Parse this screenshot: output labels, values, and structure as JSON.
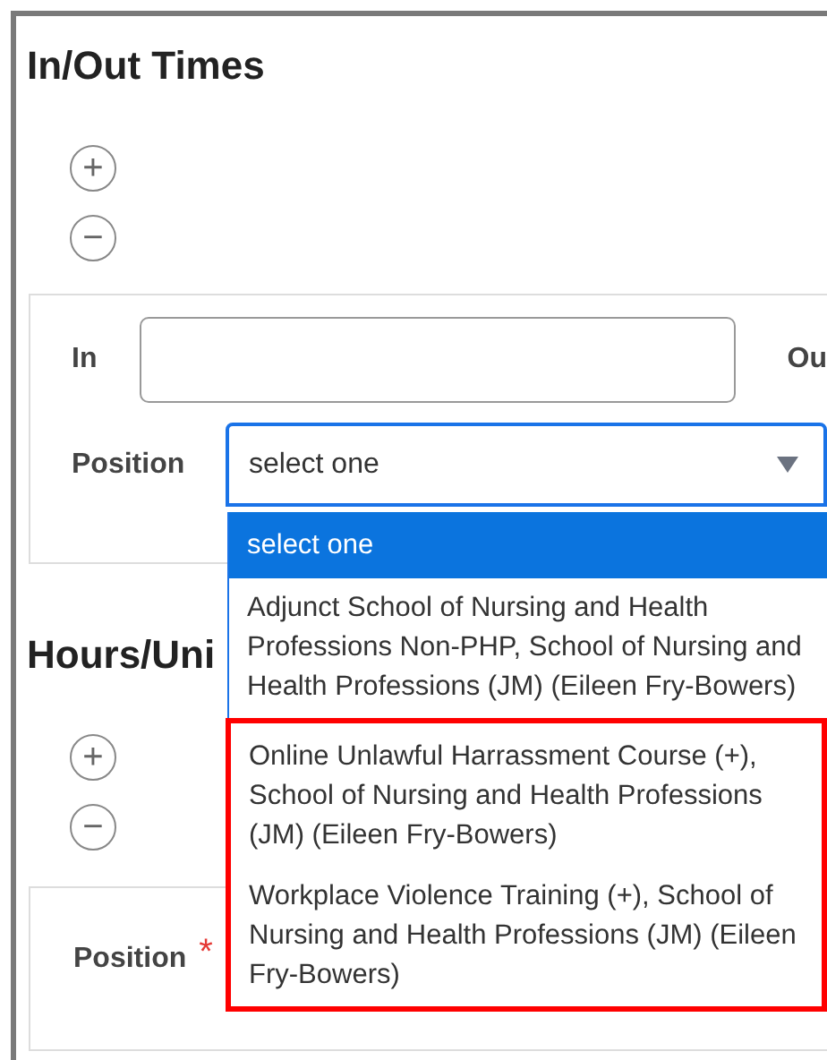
{
  "section_title": "In/Out Times",
  "add_button": {
    "label": "+"
  },
  "remove_button": {
    "label": "−"
  },
  "time_card": {
    "in_label": "In",
    "out_label": "Ou",
    "position_label": "Position",
    "position_select": {
      "value": "select one",
      "expanded": true
    }
  },
  "dropdown_options": [
    {
      "label": "select one",
      "selected": true,
      "highlighted": false
    },
    {
      "label": "Adjunct School of Nursing and Health Professions Non-PHP, School of Nursing and Health Professions (JM) (Eileen Fry-Bowers)",
      "selected": false,
      "highlighted": false
    },
    {
      "label": "Online Unlawful Harrassment Course (+), School of Nursing and Health Professions (JM) (Eileen Fry-Bowers)",
      "selected": false,
      "highlighted": true
    },
    {
      "label": "Workplace Violence Training (+), School of Nursing and Health Professions (JM) (Eileen Fry-Bowers)",
      "selected": false,
      "highlighted": true
    }
  ],
  "hours_section": {
    "title": "Hours/Uni",
    "add_button": {
      "label": "+"
    },
    "remove_button": {
      "label": "−"
    },
    "position_label": "Position",
    "position_required": true,
    "required_mark": "*"
  }
}
